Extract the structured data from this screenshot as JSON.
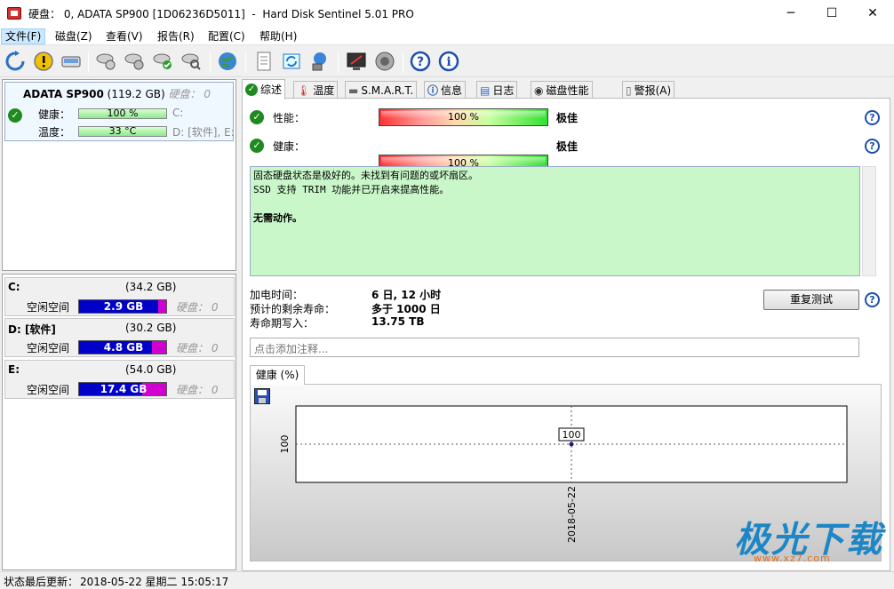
{
  "window": {
    "title": "硬盘： 0, ADATA SP900 [1D06236D5011]  -  Hard Disk Sentinel 5.01 PRO",
    "minimize": "─",
    "maximize": "☐",
    "close": "✕"
  },
  "menu": [
    "文件(F)",
    "磁盘(Z)",
    "查看(V)",
    "报告(R)",
    "配置(C)",
    "帮助(H)"
  ],
  "toolbar_icons": [
    "refresh-icon",
    "alert-icon",
    "disk-icon",
    "disk-test-icon",
    "disk-test2-icon",
    "disk-ok-icon",
    "disk-find-icon",
    "globe-icon",
    "report-icon",
    "sync-icon",
    "network-icon",
    "monitor-icon",
    "speaker-icon",
    "help-icon",
    "info-icon"
  ],
  "disk": {
    "name": "ADATA SP900",
    "size": "(119.2 GB)",
    "hdd_label": "硬盘：",
    "hdd_value": "0",
    "health_label": "健康：",
    "health_value": "100 %",
    "health_fraction": 1.0,
    "temp_label": "温度：",
    "temp_value": "33 °C",
    "temp_fraction": 1.0,
    "drives1": "C:",
    "drives2": "D: [软件], E:"
  },
  "partitions": [
    {
      "name": "C:",
      "size": "(34.2 GB)",
      "free_label": "空闲空间",
      "free": "2.9 GB",
      "free_fraction": 0.91,
      "hdd_label": "硬盘：",
      "hdd": "0"
    },
    {
      "name": "D: [软件]",
      "size": "(30.2 GB)",
      "free_label": "空闲空间",
      "free": "4.8 GB",
      "free_fraction": 0.84,
      "hdd_label": "硬盘：",
      "hdd": "0"
    },
    {
      "name": "E:",
      "size": "(54.0 GB)",
      "free_label": "空闲空间",
      "free": "17.4 GB",
      "free_fraction": 0.72,
      "hdd_label": "硬盘：",
      "hdd": "0"
    }
  ],
  "tabs": [
    "综述",
    "温度",
    "S.M.A.R.T.",
    "信息",
    "日志",
    "磁盘性能",
    "警报(A)"
  ],
  "overview": {
    "performance_label": "性能：",
    "performance_value": "100 %",
    "performance_rating": "极佳",
    "health_label": "健康：",
    "health_value": "100 %",
    "health_rating": "极佳",
    "status_line1": "固态硬盘状态是极好的。未找到有问题的或坏扇区。",
    "status_line2": "SSD 支持 TRIM 功能并已开启来提高性能。",
    "status_action": "无需动作。",
    "power_on_label": "加电时间：",
    "power_on_value": "6 日, 12 小时",
    "remaining_label": "预计的剩余寿命：",
    "remaining_value": "多于 1000 日",
    "written_label": "寿命期写入：",
    "written_value": "13.75 TB",
    "retest_label": "重复测试",
    "note_placeholder": "点击添加注释..."
  },
  "chart_data": {
    "type": "line",
    "tab_label": "健康 (%)",
    "x": [
      "2018-05-22"
    ],
    "series": [
      {
        "values": [
          100
        ]
      }
    ],
    "ylabel": "",
    "y_tick_label": "100",
    "point_label": "100"
  },
  "statusbar": {
    "label": "状态最后更新：",
    "value": "2018-05-22 星期二 15:05:17"
  },
  "watermark": {
    "text": "极光下载",
    "url": "www.xz7.com"
  }
}
